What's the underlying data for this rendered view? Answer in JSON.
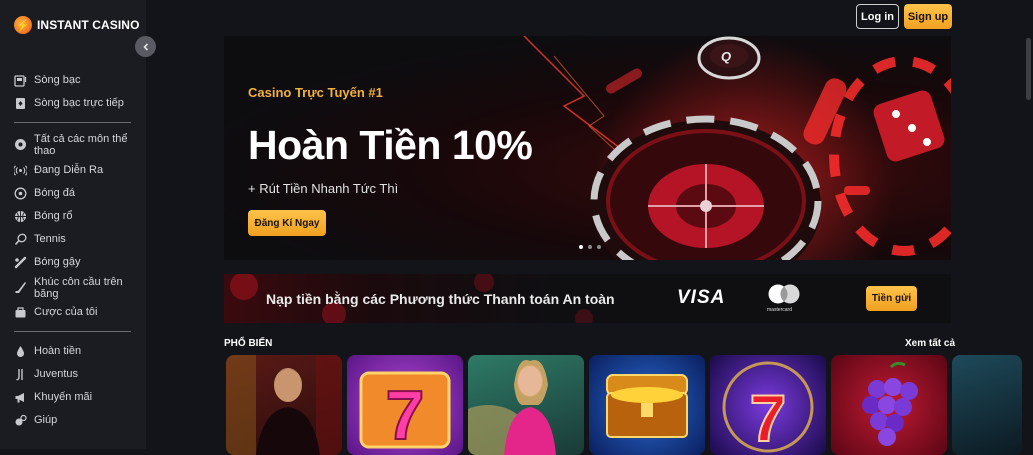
{
  "brand": {
    "name": "INSTANT CASINO",
    "logo_glyph": "⚡"
  },
  "sidebar": {
    "groups": [
      [
        {
          "label": "Sòng bạc",
          "icon": "slot-machine-icon"
        },
        {
          "label": "Sòng bạc trực tiếp",
          "icon": "live-casino-icon"
        }
      ],
      [
        {
          "label": "Tất cả các môn thể thao",
          "icon": "all-sports-icon"
        },
        {
          "label": "Đang Diễn Ra",
          "icon": "live-broadcast-icon"
        },
        {
          "label": "Bóng đá",
          "icon": "soccer-ball-icon"
        },
        {
          "label": "Bóng rổ",
          "icon": "basketball-icon"
        },
        {
          "label": "Tennis",
          "icon": "tennis-racket-icon"
        },
        {
          "label": "Bóng gậy",
          "icon": "baseball-bat-icon"
        },
        {
          "label": "Khúc côn cầu trên băng",
          "icon": "hockey-stick-icon"
        },
        {
          "label": "Cược của tôi",
          "icon": "my-bets-icon"
        }
      ],
      [
        {
          "label": "Hoàn tiền",
          "icon": "cashback-drop-icon"
        },
        {
          "label": "Juventus",
          "icon": "juventus-logo-icon"
        },
        {
          "label": "Khuyến mãi",
          "icon": "megaphone-icon"
        },
        {
          "label": "Giúp",
          "icon": "help-icon"
        }
      ]
    ]
  },
  "header": {
    "login_label": "Log in",
    "signup_label": "Sign up"
  },
  "hero": {
    "kicker": "Casino Trực Tuyến #1",
    "title": "Hoàn Tiền 10%",
    "subtitle": "+ Rút Tiền Nhanh Tức Thì",
    "cta_label": "Đăng Kí Ngay",
    "slides_total": 3,
    "active_slide": 1,
    "chip_text": "Q"
  },
  "payment_banner": {
    "text": "Nạp tiền bằng các Phương thức Thanh toán An toàn",
    "visa_label": "VISA",
    "mastercard_label": "mastercard",
    "cta_label": "Tiền gửi"
  },
  "popular": {
    "title": "PHỔ BIẾN",
    "see_all_label": "Xem tất cả",
    "games": [
      {
        "kind": "live-dealer-male",
        "bg": "#3a0e10"
      },
      {
        "kind": "lucky-seven",
        "bg": "#7a1fa8"
      },
      {
        "kind": "live-roulette-female",
        "bg": "#2b6a5a"
      },
      {
        "kind": "treasure-chest",
        "bg": "#0c2a7a"
      },
      {
        "kind": "red-seven",
        "bg": "#2a0d5e"
      },
      {
        "kind": "grapes",
        "bg": "#8a0e22"
      },
      {
        "kind": "partial",
        "bg": "#1b3a4a"
      }
    ]
  }
}
